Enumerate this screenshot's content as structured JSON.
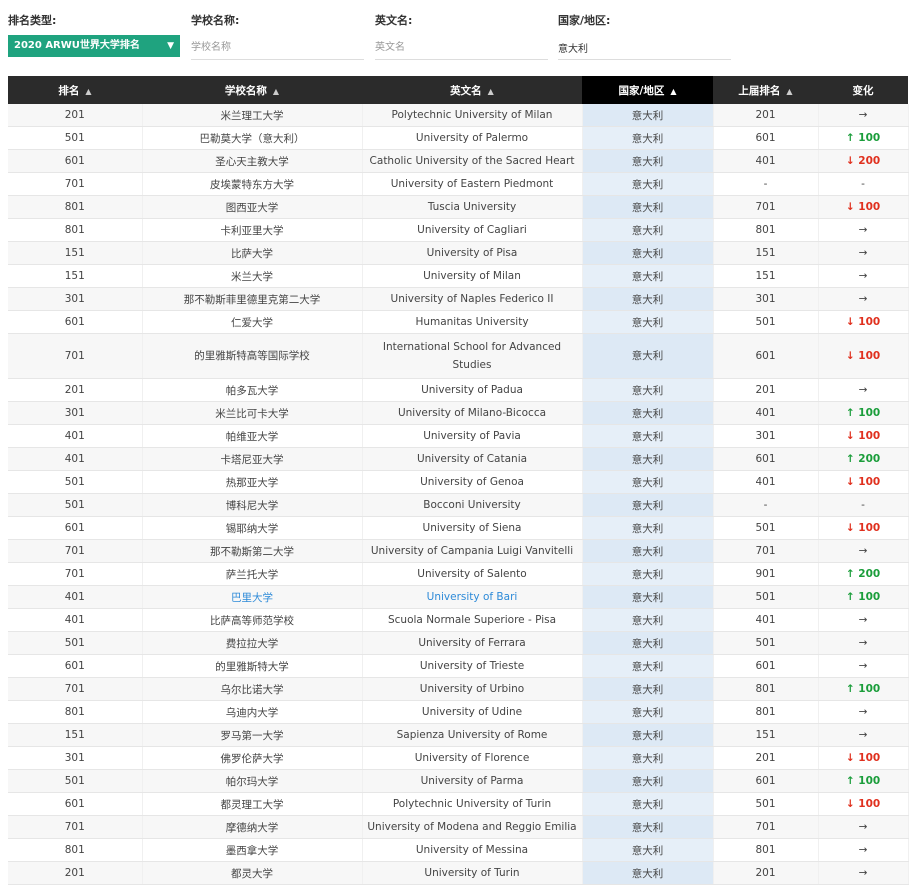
{
  "filters": {
    "ranking_type": {
      "label": "排名类型:",
      "value": "2020 ARWU世界大学排名",
      "chevron": "▼"
    },
    "school_name": {
      "label": "学校名称:",
      "placeholder": "学校名称"
    },
    "english_name": {
      "label": "英文名:",
      "placeholder": "英文名"
    },
    "country": {
      "label": "国家/地区:",
      "value": "意大利"
    }
  },
  "table": {
    "columns": [
      {
        "label": "排名",
        "sort": "▲"
      },
      {
        "label": "学校名称",
        "sort": "▲"
      },
      {
        "label": "英文名",
        "sort": "▲"
      },
      {
        "label": "国家/地区",
        "sort": "▲"
      },
      {
        "label": "上届排名",
        "sort": "▲"
      },
      {
        "label": "变化",
        "sort": ""
      }
    ],
    "rows": [
      {
        "rank": "201",
        "cn": "米兰理工大学",
        "en": "Polytechnic University of Milan",
        "country": "意大利",
        "prev": "201",
        "change": "→",
        "dir": "same"
      },
      {
        "rank": "501",
        "cn": "巴勒莫大学（意大利）",
        "en": "University of Palermo",
        "country": "意大利",
        "prev": "601",
        "change": "↑ 100",
        "dir": "up"
      },
      {
        "rank": "601",
        "cn": "圣心天主教大学",
        "en": "Catholic University of the Sacred Heart",
        "country": "意大利",
        "prev": "401",
        "change": "↓ 200",
        "dir": "down"
      },
      {
        "rank": "701",
        "cn": "皮埃蒙特东方大学",
        "en": "University of Eastern Piedmont",
        "country": "意大利",
        "prev": "-",
        "change": "-",
        "dir": "none"
      },
      {
        "rank": "801",
        "cn": "图西亚大学",
        "en": "Tuscia University",
        "country": "意大利",
        "prev": "701",
        "change": "↓ 100",
        "dir": "down"
      },
      {
        "rank": "801",
        "cn": "卡利亚里大学",
        "en": "University of Cagliari",
        "country": "意大利",
        "prev": "801",
        "change": "→",
        "dir": "same"
      },
      {
        "rank": "151",
        "cn": "比萨大学",
        "en": "University of Pisa",
        "country": "意大利",
        "prev": "151",
        "change": "→",
        "dir": "same"
      },
      {
        "rank": "151",
        "cn": "米兰大学",
        "en": "University of Milan",
        "country": "意大利",
        "prev": "151",
        "change": "→",
        "dir": "same"
      },
      {
        "rank": "301",
        "cn": "那不勒斯菲里德里克第二大学",
        "en": "University of Naples Federico II",
        "country": "意大利",
        "prev": "301",
        "change": "→",
        "dir": "same"
      },
      {
        "rank": "601",
        "cn": "仁爱大学",
        "en": "Humanitas University",
        "country": "意大利",
        "prev": "501",
        "change": "↓ 100",
        "dir": "down"
      },
      {
        "rank": "701",
        "cn": "的里雅斯特高等国际学校",
        "en": "International School for Advanced Studies",
        "country": "意大利",
        "prev": "601",
        "change": "↓ 100",
        "dir": "down",
        "tall": true
      },
      {
        "rank": "201",
        "cn": "帕多瓦大学",
        "en": "University of Padua",
        "country": "意大利",
        "prev": "201",
        "change": "→",
        "dir": "same"
      },
      {
        "rank": "301",
        "cn": "米兰比可卡大学",
        "en": "University of Milano-Bicocca",
        "country": "意大利",
        "prev": "401",
        "change": "↑ 100",
        "dir": "up"
      },
      {
        "rank": "401",
        "cn": "帕维亚大学",
        "en": "University of Pavia",
        "country": "意大利",
        "prev": "301",
        "change": "↓ 100",
        "dir": "down"
      },
      {
        "rank": "401",
        "cn": "卡塔尼亚大学",
        "en": "University of Catania",
        "country": "意大利",
        "prev": "601",
        "change": "↑ 200",
        "dir": "up"
      },
      {
        "rank": "501",
        "cn": "热那亚大学",
        "en": "University of Genoa",
        "country": "意大利",
        "prev": "401",
        "change": "↓ 100",
        "dir": "down"
      },
      {
        "rank": "501",
        "cn": "博科尼大学",
        "en": "Bocconi University",
        "country": "意大利",
        "prev": "-",
        "change": "-",
        "dir": "none"
      },
      {
        "rank": "601",
        "cn": "锡耶纳大学",
        "en": "University of Siena",
        "country": "意大利",
        "prev": "501",
        "change": "↓ 100",
        "dir": "down"
      },
      {
        "rank": "701",
        "cn": "那不勒斯第二大学",
        "en": "University of Campania Luigi Vanvitelli",
        "country": "意大利",
        "prev": "701",
        "change": "→",
        "dir": "same"
      },
      {
        "rank": "701",
        "cn": "萨兰托大学",
        "en": "University of Salento",
        "country": "意大利",
        "prev": "901",
        "change": "↑ 200",
        "dir": "up"
      },
      {
        "rank": "401",
        "cn": "巴里大学",
        "en": "University of Bari",
        "country": "意大利",
        "prev": "501",
        "change": "↑ 100",
        "dir": "up",
        "highlight": true
      },
      {
        "rank": "401",
        "cn": "比萨高等师范学校",
        "en": "Scuola Normale Superiore - Pisa",
        "country": "意大利",
        "prev": "401",
        "change": "→",
        "dir": "same"
      },
      {
        "rank": "501",
        "cn": "费拉拉大学",
        "en": "University of Ferrara",
        "country": "意大利",
        "prev": "501",
        "change": "→",
        "dir": "same"
      },
      {
        "rank": "601",
        "cn": "的里雅斯特大学",
        "en": "University of Trieste",
        "country": "意大利",
        "prev": "601",
        "change": "→",
        "dir": "same"
      },
      {
        "rank": "701",
        "cn": "乌尔比诺大学",
        "en": "University of Urbino",
        "country": "意大利",
        "prev": "801",
        "change": "↑ 100",
        "dir": "up"
      },
      {
        "rank": "801",
        "cn": "乌迪内大学",
        "en": "University of Udine",
        "country": "意大利",
        "prev": "801",
        "change": "→",
        "dir": "same"
      },
      {
        "rank": "151",
        "cn": "罗马第一大学",
        "en": "Sapienza University of Rome",
        "country": "意大利",
        "prev": "151",
        "change": "→",
        "dir": "same"
      },
      {
        "rank": "301",
        "cn": "佛罗伦萨大学",
        "en": "University of Florence",
        "country": "意大利",
        "prev": "201",
        "change": "↓ 100",
        "dir": "down"
      },
      {
        "rank": "501",
        "cn": "帕尔玛大学",
        "en": "University of Parma",
        "country": "意大利",
        "prev": "601",
        "change": "↑ 100",
        "dir": "up"
      },
      {
        "rank": "601",
        "cn": "都灵理工大学",
        "en": "Polytechnic University of Turin",
        "country": "意大利",
        "prev": "501",
        "change": "↓ 100",
        "dir": "down"
      },
      {
        "rank": "701",
        "cn": "摩德纳大学",
        "en": "University of Modena and Reggio Emilia",
        "country": "意大利",
        "prev": "701",
        "change": "→",
        "dir": "same"
      },
      {
        "rank": "801",
        "cn": "墨西拿大学",
        "en": "University of Messina",
        "country": "意大利",
        "prev": "801",
        "change": "→",
        "dir": "same"
      },
      {
        "rank": "201",
        "cn": "都灵大学",
        "en": "University of Turin",
        "country": "意大利",
        "prev": "201",
        "change": "→",
        "dir": "same"
      }
    ]
  }
}
